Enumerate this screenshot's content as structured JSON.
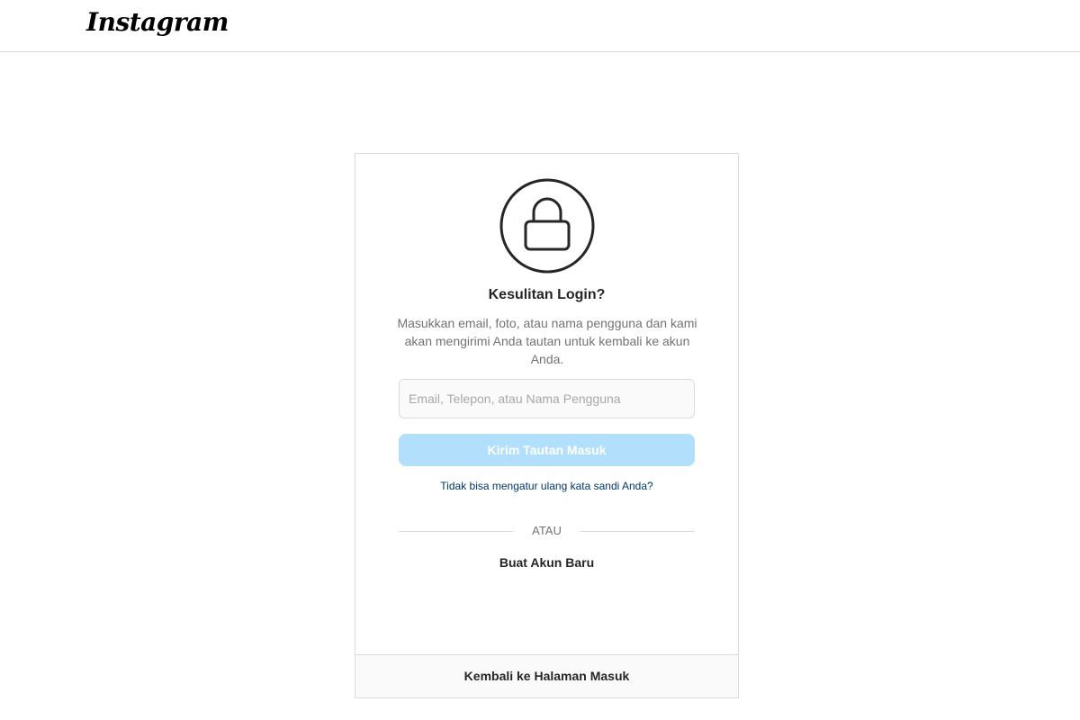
{
  "header": {
    "logo_text": "Instagram"
  },
  "card": {
    "lock_icon": "lock-icon",
    "title": "Kesulitan Login?",
    "description": "Masukkan email, foto, atau nama pengguna dan kami akan mengirimi Anda tautan untuk kembali ke akun Anda.",
    "input": {
      "placeholder": "Email, Telepon, atau Nama Pengguna",
      "value": ""
    },
    "send_button_label": "Kirim Tautan Masuk",
    "reset_link_label": "Tidak bisa mengatur ulang kata sandi Anda?",
    "divider_text": "ATAU",
    "create_account_label": "Buat Akun Baru",
    "back_to_login_label": "Kembali ke Halaman Masuk"
  },
  "colors": {
    "accent_disabled": "#b2dffc",
    "link": "#00376b",
    "border": "#dbdbdb"
  }
}
